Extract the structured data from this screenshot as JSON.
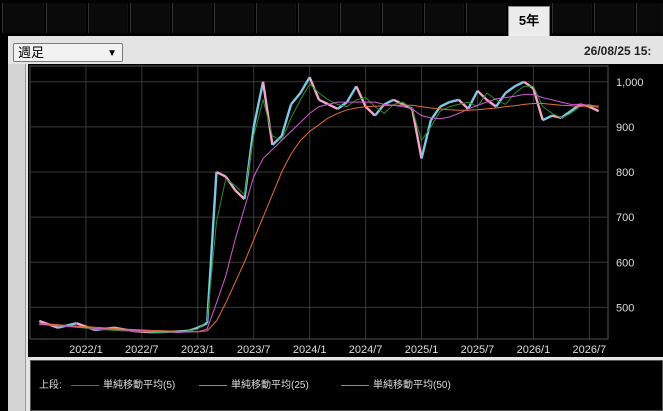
{
  "tabs": {
    "active_label": "5年"
  },
  "toolbar": {
    "period_select": "週足",
    "datetime": "26/08/25 15:"
  },
  "legend": {
    "prefix": "上段:",
    "items": [
      {
        "label": "単純移動平均(5)",
        "color": "#2e8b2e"
      },
      {
        "label": "単純移動平均(25)",
        "color": "#d45ad4"
      },
      {
        "label": "単純移動平均(50)",
        "color": "#e0703a"
      }
    ]
  },
  "colors": {
    "up": "#7ec8e3",
    "down": "#f0a6c8",
    "grid": "#3a3a3a",
    "axis_text": "#dddddd"
  },
  "chart_data": {
    "type": "line",
    "ylim": [
      430,
      1035
    ],
    "yticks": [
      500,
      600,
      700,
      800,
      900,
      1000
    ],
    "ytick_labels": [
      "500",
      "600",
      "700",
      "800",
      "900",
      "1,000"
    ],
    "xticks": [
      "2022/1",
      "2022/7",
      "2023/1",
      "2023/7",
      "2024/1",
      "2024/7",
      "2025/1",
      "2025/7",
      "2026/1",
      "2026/7"
    ],
    "x_start": "2021/7",
    "x_end": "2026/9",
    "series": [
      {
        "name": "単純移動平均(5)",
        "points": [
          [
            "2021/8",
            462
          ],
          [
            "2021/11",
            458
          ],
          [
            "2022/2",
            452
          ],
          [
            "2022/5",
            448
          ],
          [
            "2022/8",
            446
          ],
          [
            "2022/11",
            444
          ],
          [
            "2023/1",
            452
          ],
          [
            "2023/2",
            470
          ],
          [
            "2023/3",
            690
          ],
          [
            "2023/4",
            785
          ],
          [
            "2023/5",
            770
          ],
          [
            "2023/6",
            750
          ],
          [
            "2023/7",
            880
          ],
          [
            "2023/8",
            960
          ],
          [
            "2023/9",
            880
          ],
          [
            "2023/10",
            870
          ],
          [
            "2023/11",
            920
          ],
          [
            "2023/12",
            960
          ],
          [
            "2024/1",
            995
          ],
          [
            "2024/2",
            975
          ],
          [
            "2024/3",
            960
          ],
          [
            "2024/4",
            950
          ],
          [
            "2024/5",
            945
          ],
          [
            "2024/6",
            960
          ],
          [
            "2024/7",
            965
          ],
          [
            "2024/8",
            945
          ],
          [
            "2024/9",
            930
          ],
          [
            "2024/10",
            950
          ],
          [
            "2024/11",
            955
          ],
          [
            "2024/12",
            940
          ],
          [
            "2025/1",
            870
          ],
          [
            "2025/2",
            900
          ],
          [
            "2025/3",
            935
          ],
          [
            "2025/4",
            945
          ],
          [
            "2025/5",
            950
          ],
          [
            "2025/6",
            955
          ],
          [
            "2025/7",
            945
          ],
          [
            "2025/8",
            975
          ],
          [
            "2025/9",
            960
          ],
          [
            "2025/10",
            950
          ],
          [
            "2025/11",
            975
          ],
          [
            "2025/12",
            990
          ],
          [
            "2026/1",
            990
          ],
          [
            "2026/2",
            945
          ],
          [
            "2026/3",
            930
          ],
          [
            "2026/4",
            920
          ],
          [
            "2026/5",
            930
          ],
          [
            "2026/6",
            945
          ],
          [
            "2026/7",
            950
          ],
          [
            "2026/8",
            942
          ]
        ]
      },
      {
        "name": "単純移動平均(25)",
        "points": [
          [
            "2021/8",
            463
          ],
          [
            "2021/11",
            458
          ],
          [
            "2022/2",
            454
          ],
          [
            "2022/5",
            450
          ],
          [
            "2022/8",
            447
          ],
          [
            "2022/11",
            445
          ],
          [
            "2023/1",
            446
          ],
          [
            "2023/2",
            452
          ],
          [
            "2023/3",
            510
          ],
          [
            "2023/4",
            570
          ],
          [
            "2023/5",
            650
          ],
          [
            "2023/6",
            720
          ],
          [
            "2023/7",
            790
          ],
          [
            "2023/8",
            830
          ],
          [
            "2023/9",
            850
          ],
          [
            "2023/10",
            870
          ],
          [
            "2023/11",
            890
          ],
          [
            "2023/12",
            910
          ],
          [
            "2024/1",
            930
          ],
          [
            "2024/2",
            945
          ],
          [
            "2024/3",
            950
          ],
          [
            "2024/4",
            955
          ],
          [
            "2024/5",
            955
          ],
          [
            "2024/6",
            955
          ],
          [
            "2024/7",
            955
          ],
          [
            "2024/8",
            955
          ],
          [
            "2024/9",
            950
          ],
          [
            "2024/10",
            948
          ],
          [
            "2024/11",
            945
          ],
          [
            "2024/12",
            940
          ],
          [
            "2025/1",
            925
          ],
          [
            "2025/2",
            920
          ],
          [
            "2025/3",
            918
          ],
          [
            "2025/4",
            922
          ],
          [
            "2025/5",
            930
          ],
          [
            "2025/6",
            940
          ],
          [
            "2025/7",
            948
          ],
          [
            "2025/8",
            955
          ],
          [
            "2025/9",
            962
          ],
          [
            "2025/10",
            965
          ],
          [
            "2025/11",
            968
          ],
          [
            "2025/12",
            972
          ],
          [
            "2026/1",
            972
          ],
          [
            "2026/2",
            965
          ],
          [
            "2026/3",
            960
          ],
          [
            "2026/4",
            955
          ],
          [
            "2026/5",
            950
          ],
          [
            "2026/6",
            950
          ],
          [
            "2026/7",
            948
          ],
          [
            "2026/8",
            946
          ]
        ]
      },
      {
        "name": "単純移動平均(50)",
        "points": [
          [
            "2021/8",
            465
          ],
          [
            "2021/11",
            460
          ],
          [
            "2022/2",
            456
          ],
          [
            "2022/5",
            452
          ],
          [
            "2022/8",
            449
          ],
          [
            "2022/11",
            447
          ],
          [
            "2023/1",
            446
          ],
          [
            "2023/2",
            448
          ],
          [
            "2023/3",
            470
          ],
          [
            "2023/4",
            510
          ],
          [
            "2023/5",
            555
          ],
          [
            "2023/6",
            600
          ],
          [
            "2023/7",
            650
          ],
          [
            "2023/8",
            700
          ],
          [
            "2023/9",
            750
          ],
          [
            "2023/10",
            800
          ],
          [
            "2023/11",
            840
          ],
          [
            "2023/12",
            870
          ],
          [
            "2024/1",
            890
          ],
          [
            "2024/2",
            905
          ],
          [
            "2024/3",
            920
          ],
          [
            "2024/4",
            930
          ],
          [
            "2024/5",
            938
          ],
          [
            "2024/6",
            942
          ],
          [
            "2024/7",
            945
          ],
          [
            "2024/8",
            946
          ],
          [
            "2024/9",
            947
          ],
          [
            "2024/10",
            948
          ],
          [
            "2024/11",
            948
          ],
          [
            "2024/12",
            948
          ],
          [
            "2025/1",
            945
          ],
          [
            "2025/2",
            942
          ],
          [
            "2025/3",
            940
          ],
          [
            "2025/4",
            938
          ],
          [
            "2025/5",
            937
          ],
          [
            "2025/6",
            937
          ],
          [
            "2025/7",
            938
          ],
          [
            "2025/8",
            940
          ],
          [
            "2025/9",
            942
          ],
          [
            "2025/10",
            945
          ],
          [
            "2025/11",
            947
          ],
          [
            "2025/12",
            950
          ],
          [
            "2026/1",
            952
          ],
          [
            "2026/2",
            952
          ],
          [
            "2026/3",
            950
          ],
          [
            "2026/4",
            948
          ],
          [
            "2026/5",
            947
          ],
          [
            "2026/6",
            946
          ],
          [
            "2026/7",
            946
          ],
          [
            "2026/8",
            946
          ]
        ]
      }
    ],
    "price_points": [
      [
        "2021/8",
        470
      ],
      [
        "2021/10",
        455
      ],
      [
        "2021/12",
        465
      ],
      [
        "2022/2",
        450
      ],
      [
        "2022/4",
        455
      ],
      [
        "2022/6",
        448
      ],
      [
        "2022/8",
        445
      ],
      [
        "2022/10",
        446
      ],
      [
        "2022/12",
        448
      ],
      [
        "2023/1",
        455
      ],
      [
        "2023/2",
        465
      ],
      [
        "2023/3",
        800
      ],
      [
        "2023/4",
        790
      ],
      [
        "2023/5",
        760
      ],
      [
        "2023/6",
        740
      ],
      [
        "2023/7",
        900
      ],
      [
        "2023/8",
        1000
      ],
      [
        "2023/9",
        860
      ],
      [
        "2023/10",
        880
      ],
      [
        "2023/11",
        950
      ],
      [
        "2023/12",
        975
      ],
      [
        "2024/1",
        1010
      ],
      [
        "2024/2",
        960
      ],
      [
        "2024/3",
        950
      ],
      [
        "2024/4",
        940
      ],
      [
        "2024/5",
        955
      ],
      [
        "2024/6",
        990
      ],
      [
        "2024/7",
        945
      ],
      [
        "2024/8",
        925
      ],
      [
        "2024/9",
        950
      ],
      [
        "2024/10",
        960
      ],
      [
        "2024/11",
        950
      ],
      [
        "2024/12",
        940
      ],
      [
        "2025/1",
        830
      ],
      [
        "2025/2",
        915
      ],
      [
        "2025/3",
        945
      ],
      [
        "2025/4",
        955
      ],
      [
        "2025/5",
        960
      ],
      [
        "2025/6",
        940
      ],
      [
        "2025/7",
        980
      ],
      [
        "2025/8",
        960
      ],
      [
        "2025/9",
        945
      ],
      [
        "2025/10",
        975
      ],
      [
        "2025/11",
        990
      ],
      [
        "2025/12",
        1000
      ],
      [
        "2026/1",
        985
      ],
      [
        "2026/2",
        915
      ],
      [
        "2026/3",
        925
      ],
      [
        "2026/4",
        920
      ],
      [
        "2026/5",
        935
      ],
      [
        "2026/6",
        950
      ],
      [
        "2026/7",
        945
      ],
      [
        "2026/8",
        935
      ]
    ]
  }
}
